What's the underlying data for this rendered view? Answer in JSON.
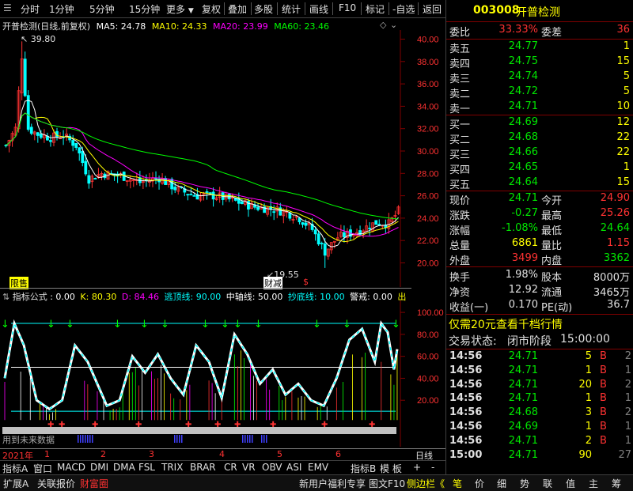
{
  "toolbar": {
    "left_items": [
      "分时",
      "1分钟",
      "5分钟",
      "15分钟",
      "更多"
    ],
    "right_items": [
      "复权",
      "叠加",
      "多股",
      "统计",
      "画线",
      "F10",
      "标记",
      "-自选",
      "返回"
    ]
  },
  "chart": {
    "title": "开普检测(日线,前复权)",
    "ma_labels": [
      {
        "text": "MA5: 24.78",
        "color": "#ffffff"
      },
      {
        "text": "MA10: 24.33",
        "color": "#ffff00"
      },
      {
        "text": "MA20: 23.99",
        "color": "#ff00ff"
      },
      {
        "text": "MA60: 23.46",
        "color": "#00ff00"
      }
    ],
    "y_ticks": [
      "40.00",
      "38.00",
      "36.00",
      "34.00",
      "32.00",
      "30.00",
      "28.00",
      "26.00",
      "24.00",
      "22.00",
      "20.00"
    ],
    "high_label": "39.80",
    "low_label": "19.55",
    "markers": [
      "限售",
      "财减",
      "$"
    ]
  },
  "indicator": {
    "name": "指标公式",
    "values": [
      {
        "text": ": 0.00",
        "color": "#ffffff"
      },
      {
        "text": "K: 80.30",
        "color": "#ffff00"
      },
      {
        "text": "D: 84.46",
        "color": "#ff00ff"
      },
      {
        "text": "逃顶线: 90.00",
        "color": "#00ffff"
      },
      {
        "text": "中轴线: 50.00",
        "color": "#ffffff"
      },
      {
        "text": "抄底线: 10.00",
        "color": "#00ffff"
      },
      {
        "text": "警戒: 0.00",
        "color": "#ffffff"
      },
      {
        "text": "出",
        "color": "#ffff00"
      }
    ],
    "y_ticks": [
      "100.00",
      "80.00",
      "60.00",
      "40.00",
      "20.00"
    ],
    "future_label": "用到未来数据"
  },
  "time_axis": {
    "labels": [
      "2021年",
      "1",
      "2",
      "3",
      "4",
      "5",
      "6"
    ],
    "period": "日线"
  },
  "indicator_tabs": [
    "指标A",
    "窗口",
    "MACD",
    "DMI",
    "DMA",
    "FSL",
    "TRIX",
    "BRAR",
    "CR",
    "VR",
    "OBV",
    "ASI",
    "EMV"
  ],
  "indicator_tabs_right": [
    "指标B",
    "模 板",
    "+",
    "-"
  ],
  "status_left": [
    "扩展A",
    "关联报价",
    "财富圈"
  ],
  "status_mid": "新用户福利专享",
  "status_mid2": [
    "图文F10",
    "侧边栏《"
  ],
  "status_right": [
    "笔",
    "价",
    "细",
    "势",
    "联",
    "值",
    "主",
    "筹"
  ],
  "quote": {
    "code": "003008",
    "name": "开普检测",
    "weibi_label": "委比",
    "weibi": "33.33%",
    "weicha_label": "委差",
    "weicha": "36",
    "asks": [
      {
        "label": "卖五",
        "price": "24.77",
        "vol": "1"
      },
      {
        "label": "卖四",
        "price": "24.75",
        "vol": "15"
      },
      {
        "label": "卖三",
        "price": "24.74",
        "vol": "5"
      },
      {
        "label": "卖二",
        "price": "24.72",
        "vol": "5"
      },
      {
        "label": "卖一",
        "price": "24.71",
        "vol": "10"
      }
    ],
    "bids": [
      {
        "label": "买一",
        "price": "24.69",
        "vol": "12"
      },
      {
        "label": "买二",
        "price": "24.68",
        "vol": "22"
      },
      {
        "label": "买三",
        "price": "24.66",
        "vol": "22"
      },
      {
        "label": "买四",
        "price": "24.65",
        "vol": "1"
      },
      {
        "label": "买五",
        "price": "24.64",
        "vol": "15"
      }
    ],
    "stats": [
      {
        "l1": "现价",
        "v1": "24.71",
        "c1": "#00e600",
        "l2": "今开",
        "v2": "24.90",
        "c2": "#ff3232"
      },
      {
        "l1": "涨跌",
        "v1": "-0.27",
        "c1": "#00e600",
        "l2": "最高",
        "v2": "25.26",
        "c2": "#ff3232"
      },
      {
        "l1": "涨幅",
        "v1": "-1.08%",
        "c1": "#00e600",
        "l2": "最低",
        "v2": "24.64",
        "c2": "#00e600"
      },
      {
        "l1": "总量",
        "v1": "6861",
        "c1": "#ffff00",
        "l2": "量比",
        "v2": "1.15",
        "c2": "#ff3232"
      },
      {
        "l1": "外盘",
        "v1": "3499",
        "c1": "#ff3232",
        "l2": "内盘",
        "v2": "3362",
        "c2": "#00e600"
      }
    ],
    "stats2": [
      {
        "l1": "换手",
        "v1": "1.98%",
        "l2": "股本",
        "v2": "8000万"
      },
      {
        "l1": "净资",
        "v1": "12.92",
        "l2": "流通",
        "v2": "3465万"
      },
      {
        "l1": "收益(一)",
        "v1": "0.170",
        "l2": "PE(动)",
        "v2": "36.7"
      }
    ],
    "promo": "仅需20元查看千档行情",
    "trade_state_label": "交易状态:",
    "trade_state": "闭市阶段",
    "trade_time": "15:00:00",
    "ticks": [
      {
        "time": "14:56",
        "price": "24.71",
        "vol": "5",
        "bs": "B",
        "n": "2"
      },
      {
        "time": "14:56",
        "price": "24.71",
        "vol": "1",
        "bs": "B",
        "n": "1"
      },
      {
        "time": "14:56",
        "price": "24.71",
        "vol": "20",
        "bs": "B",
        "n": "2"
      },
      {
        "time": "14:56",
        "price": "24.71",
        "vol": "1",
        "bs": "B",
        "n": "1"
      },
      {
        "time": "14:56",
        "price": "24.68",
        "vol": "3",
        "bs": "B",
        "n": "2"
      },
      {
        "time": "14:56",
        "price": "24.69",
        "vol": "1",
        "bs": "B",
        "n": "1"
      },
      {
        "time": "14:56",
        "price": "24.71",
        "vol": "2",
        "bs": "B",
        "n": "1"
      },
      {
        "time": "15:00",
        "price": "24.71",
        "vol": "90",
        "bs": "",
        "n": "27"
      }
    ]
  }
}
